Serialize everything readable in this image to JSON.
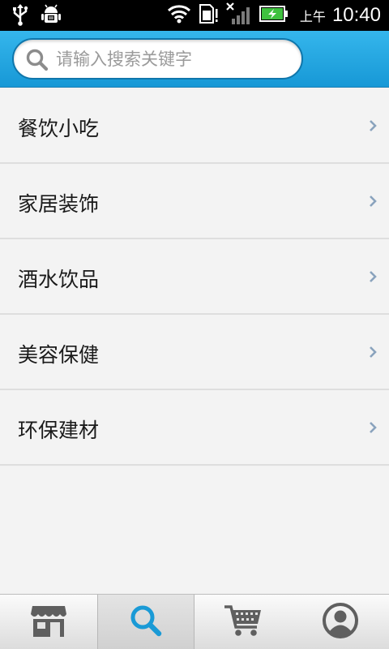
{
  "status_bar": {
    "ampm": "上午",
    "time": "10:40",
    "icons": [
      "usb-icon",
      "android-debug-icon",
      "wifi-icon",
      "sd-card-icon",
      "no-signal-icon",
      "battery-charging-icon"
    ]
  },
  "search": {
    "placeholder": "请输入搜索关键字",
    "value": ""
  },
  "categories": [
    {
      "label": "餐饮小吃"
    },
    {
      "label": "家居装饰"
    },
    {
      "label": "酒水饮品"
    },
    {
      "label": "美容保健"
    },
    {
      "label": "环保建材"
    }
  ],
  "tabs": [
    {
      "icon": "store-icon",
      "active": false
    },
    {
      "icon": "search-icon",
      "active": true
    },
    {
      "icon": "cart-icon",
      "active": false
    },
    {
      "icon": "user-profile-icon",
      "active": false
    }
  ],
  "colors": {
    "header": "#1fa6e2",
    "accent": "#1a9ad6",
    "chevron": "#8aa3bd"
  }
}
